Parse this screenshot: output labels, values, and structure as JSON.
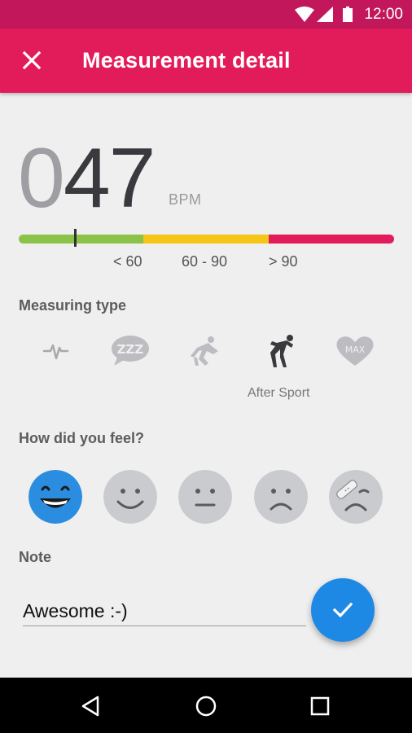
{
  "status_bar": {
    "time": "12:00",
    "icons": [
      "wifi-icon",
      "signal-icon",
      "battery-icon"
    ]
  },
  "app_bar": {
    "title": "Measurement detail",
    "close_icon": "close-icon",
    "color": "#e21b5a"
  },
  "measurement": {
    "value_leading": "0",
    "value_main": "47",
    "unit": "BPM",
    "range_labels": [
      "< 60",
      "60 - 90",
      "> 90"
    ],
    "range_colors": [
      "#8bc34a",
      "#f5c518",
      "#e21b5a"
    ]
  },
  "measuring_type": {
    "heading": "Measuring type",
    "options": [
      "pulse-icon",
      "sleep-icon",
      "start-position-icon",
      "after-sport-icon",
      "max-heart-icon"
    ],
    "max_icon_label": "MAX",
    "sleep_icon_label": "ZZZ",
    "selected_label": "After Sport"
  },
  "feeling": {
    "heading": "How did you feel?",
    "options": [
      "very-happy-face",
      "happy-face",
      "neutral-face",
      "sad-face",
      "hurt-face"
    ],
    "selected_color": "#2b8de0"
  },
  "note": {
    "heading": "Note",
    "value": "Awesome :-)"
  },
  "fab": {
    "icon": "check-icon",
    "color": "#1e88e5"
  },
  "nav_bar": {
    "icons": [
      "back-icon",
      "home-icon",
      "recents-icon"
    ]
  }
}
